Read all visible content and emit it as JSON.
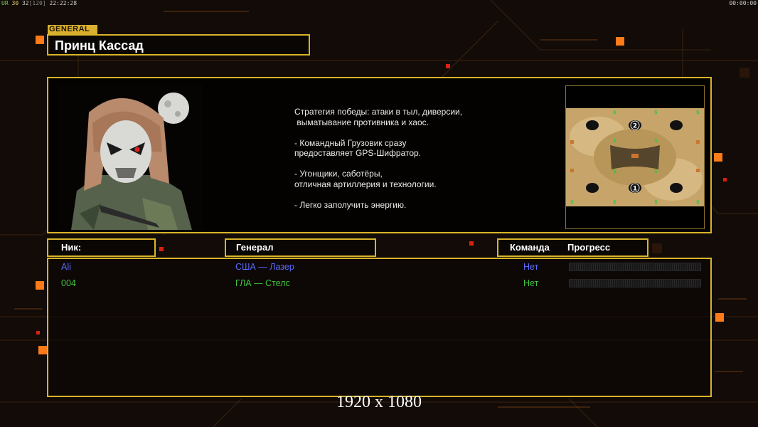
{
  "debug": {
    "label": "UR",
    "fps": "30",
    "value": "32",
    "cap": "[120]",
    "clock": "22:22:28",
    "timer": "00:00:00"
  },
  "general": {
    "tag": "GENERAL",
    "name": "Принц Кассад"
  },
  "description": [
    "Стратегия победы: атаки в тыл, диверсии,",
    " выматывание противника и хаос.",
    "",
    "- Командный Грузовик сразу",
    "предоставляет GPS-Шифратор.",
    "",
    "- Угонщики, саботёры,",
    "отличная артиллерия и технологии.",
    "",
    "- Легко заполучить энергию."
  ],
  "map": {
    "start_positions": [
      "2",
      "1"
    ],
    "icons": [
      "portrait-icon",
      "map-preview-icon"
    ]
  },
  "columns": {
    "nick": "Ник:",
    "general": "Генерал",
    "team": "Команда",
    "progress": "Прогресс"
  },
  "players": [
    {
      "nick": "Ali",
      "general": "США — Лазер",
      "team": "Нет",
      "color": "#5a6cff",
      "progress": 0
    },
    {
      "nick": "004",
      "general": "ГЛА — Стелс",
      "team": "Нет",
      "color": "#3ec43e",
      "progress": 0
    }
  ],
  "colors": {
    "accent": "#d8b42a",
    "usa": "#5a6cff",
    "gla": "#3ec43e"
  },
  "resolution_label": "1920 x 1080"
}
